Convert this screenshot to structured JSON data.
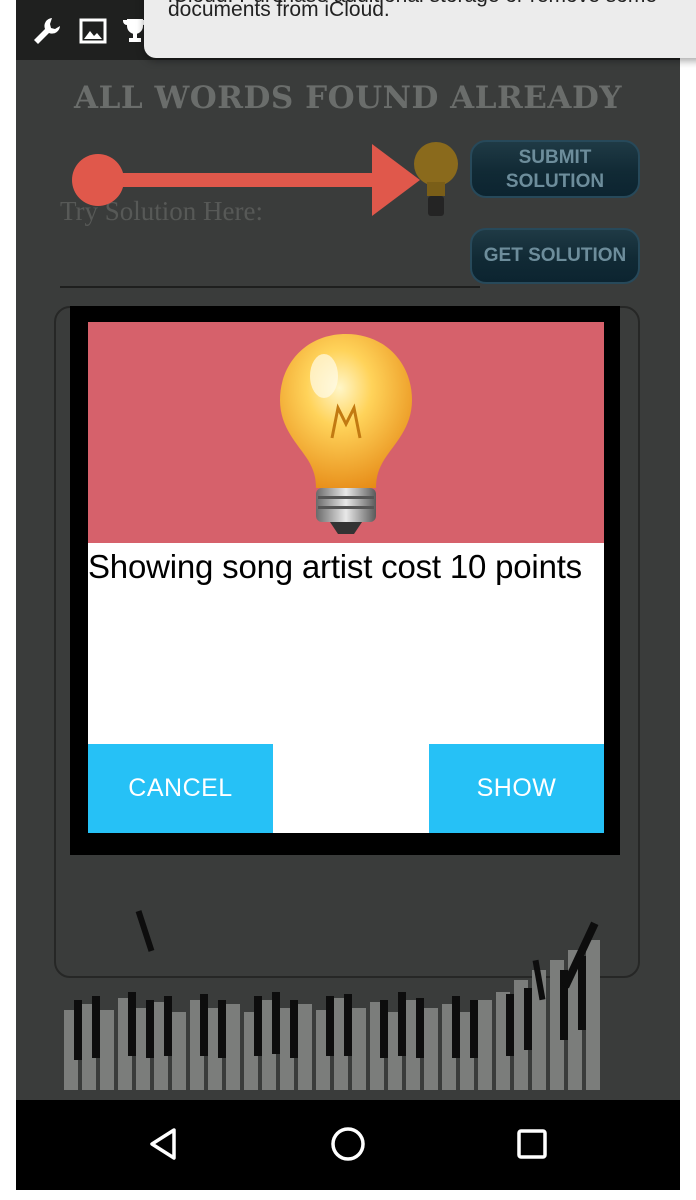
{
  "notification": {
    "line1": "iCloud. Purchase additional storage or remove some",
    "line2": "documents from iCloud."
  },
  "status_bar": {
    "icons": [
      "wrench-icon",
      "image-icon",
      "trophy-icon"
    ]
  },
  "game": {
    "heading": "ALL WORDS FOUND ALREADY",
    "try_label": "Try Solution Here:",
    "submit_button": {
      "line1": "SUBMIT",
      "line2": "SOLUTION"
    },
    "get_solution_button": "GET SOLUTION",
    "hint_icon": "lightbulb-icon"
  },
  "dialog": {
    "icon": "lightbulb-icon",
    "message": "Showing song artist cost 10 points",
    "cancel_label": "CANCEL",
    "show_label": "SHOW"
  },
  "nav_bar": {
    "icons": [
      "back-triangle-icon",
      "home-circle-icon",
      "recents-square-icon"
    ]
  },
  "colors": {
    "dialog_header": "#d6616b",
    "button": "#26c1f6",
    "arrow": "#e0584b",
    "screen_bg": "#3a3c3b"
  }
}
